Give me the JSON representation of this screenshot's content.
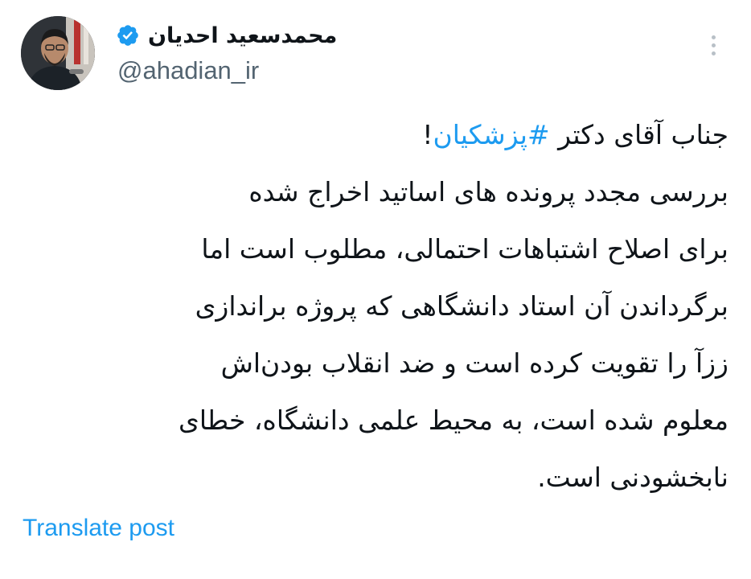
{
  "author": {
    "display_name": "محمدسعید احدیان",
    "handle": "@ahadian_ir",
    "verified": true,
    "avatar_icon": "profile-photo"
  },
  "menu": {
    "icon": "more-vertical-icon"
  },
  "post": {
    "line1_prefix": "جناب آقای دکتر ",
    "hashtag": "#پزشکیان",
    "line1_suffix": "!",
    "lines": [
      "بررسی مجدد پرونده های اساتید اخراج شده",
      "برای اصلاح اشتباهات احتمالی، مطلوب است اما",
      "برگرداندن آن استاد دانشگاهی که پروژه براندازی",
      "ززآ را تقویت کرده است و ضد انقلاب بودن‌اش",
      "معلوم شده است، به محیط علمی دانشگاه، خطای",
      "نابخشودنی است."
    ]
  },
  "actions": {
    "translate_label": "Translate post"
  },
  "colors": {
    "link": "#1d9bf0",
    "text": "#0f1419",
    "secondary": "#536471",
    "background": "#ffffff"
  }
}
